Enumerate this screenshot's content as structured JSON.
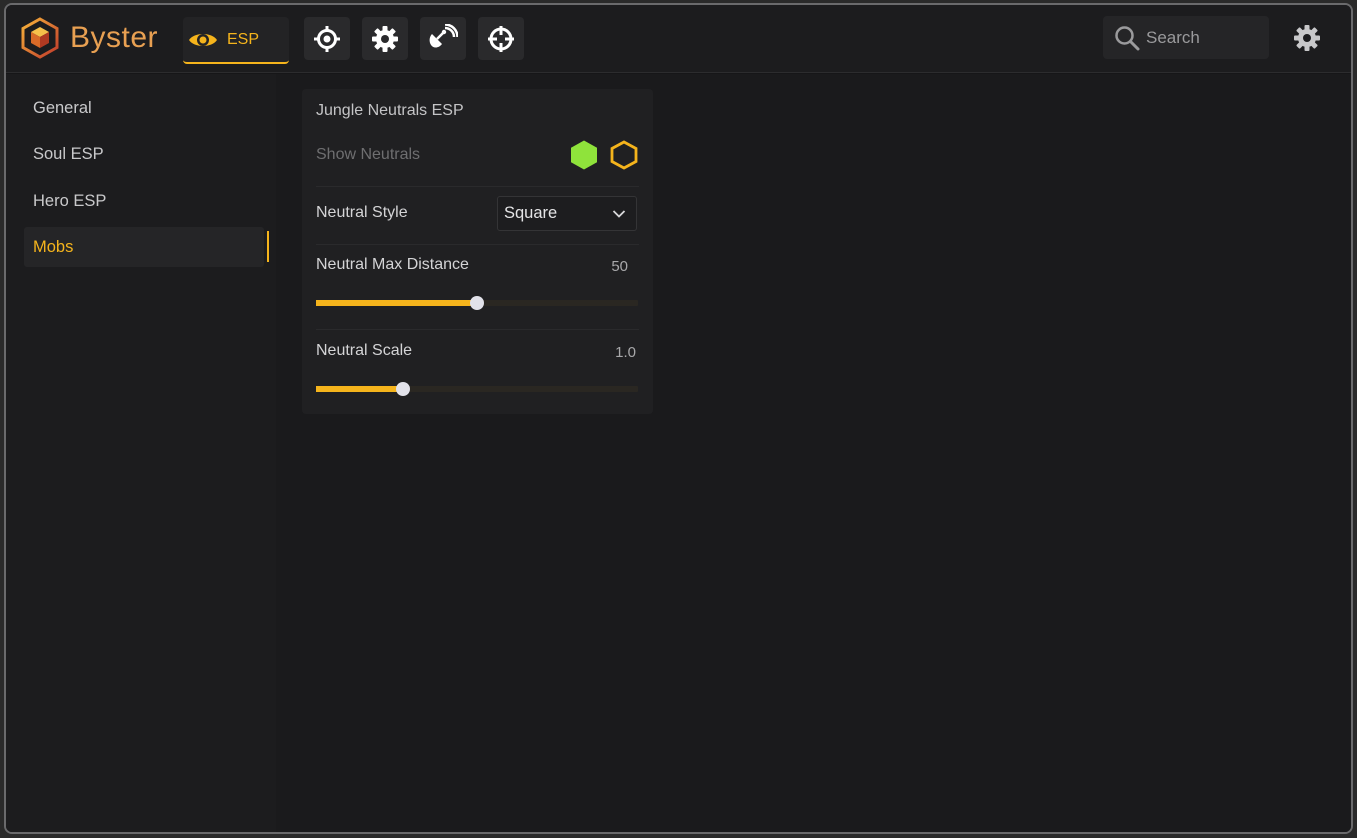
{
  "app": {
    "name": "Byster"
  },
  "tabs": [
    {
      "label": "ESP",
      "icon": "eye-icon",
      "active": true
    },
    {
      "label": "",
      "icon": "target-icon"
    },
    {
      "label": "",
      "icon": "gear-icon"
    },
    {
      "label": "",
      "icon": "satellite-icon"
    },
    {
      "label": "",
      "icon": "crosshair-icon"
    }
  ],
  "search": {
    "placeholder": "Search"
  },
  "sidebar": {
    "items": [
      {
        "label": "General"
      },
      {
        "label": "Soul ESP"
      },
      {
        "label": "Hero ESP"
      },
      {
        "label": "Mobs",
        "active": true
      }
    ]
  },
  "card": {
    "title": "Jungle Neutrals ESP",
    "show_neutrals": {
      "label": "Show Neutrals",
      "color_enabled": "#8fe33b",
      "color_outline": "#f5b41c"
    },
    "style": {
      "label": "Neutral Style",
      "value": "Square"
    },
    "max_distance": {
      "label": "Neutral Max Distance",
      "value": "50",
      "fraction": 0.5
    },
    "scale": {
      "label": "Neutral Scale",
      "value": "1.0",
      "fraction": 0.27
    }
  },
  "colors": {
    "accent": "#f5b41c",
    "background": "#161618"
  }
}
